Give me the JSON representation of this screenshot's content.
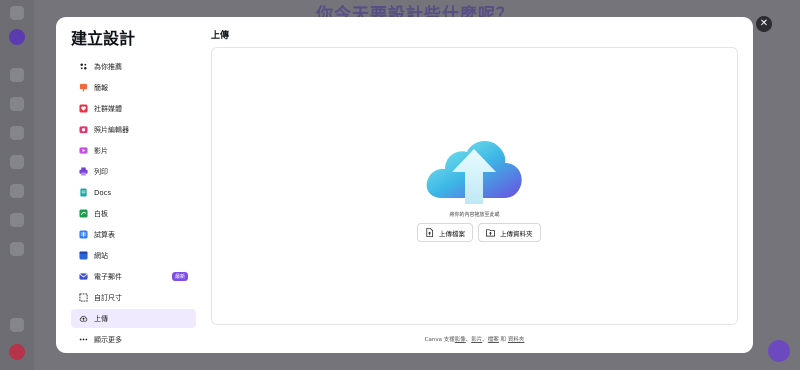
{
  "background": {
    "headline": "你今天要設計些什麼呢？"
  },
  "modal": {
    "title": "建立設計",
    "section_title": "上傳",
    "nav": [
      {
        "label": "為你推薦",
        "icon": "sparkle-icon"
      },
      {
        "label": "簡報",
        "icon": "presentation-icon"
      },
      {
        "label": "社群媒體",
        "icon": "heart-icon"
      },
      {
        "label": "照片編輯器",
        "icon": "camera-icon"
      },
      {
        "label": "影片",
        "icon": "video-icon"
      },
      {
        "label": "列印",
        "icon": "printer-icon"
      },
      {
        "label": "Docs",
        "icon": "docs-icon"
      },
      {
        "label": "白板",
        "icon": "whiteboard-icon"
      },
      {
        "label": "試算表",
        "icon": "spreadsheet-icon"
      },
      {
        "label": "網站",
        "icon": "website-icon"
      },
      {
        "label": "電子郵件",
        "icon": "email-icon",
        "badge": "最新"
      },
      {
        "label": "自訂尺寸",
        "icon": "custom-size-icon"
      },
      {
        "label": "上傳",
        "icon": "upload-cloud-icon",
        "active": true
      },
      {
        "label": "顯示更多",
        "icon": "more-icon"
      }
    ],
    "drop_text": "將你的內容拖放至此或",
    "upload_file_label": "上傳檔案",
    "upload_folder_label": "上傳資料夾",
    "footer": {
      "prefix": "Canva 支援",
      "images": "影像",
      "sep1": "、",
      "videos": "影片",
      "sep2": "、",
      "files": "檔案",
      "and": " 和 ",
      "folders": "資料夾"
    }
  },
  "colors": {
    "accent": "#7d4ee0",
    "active_bg": "#efeafd"
  }
}
